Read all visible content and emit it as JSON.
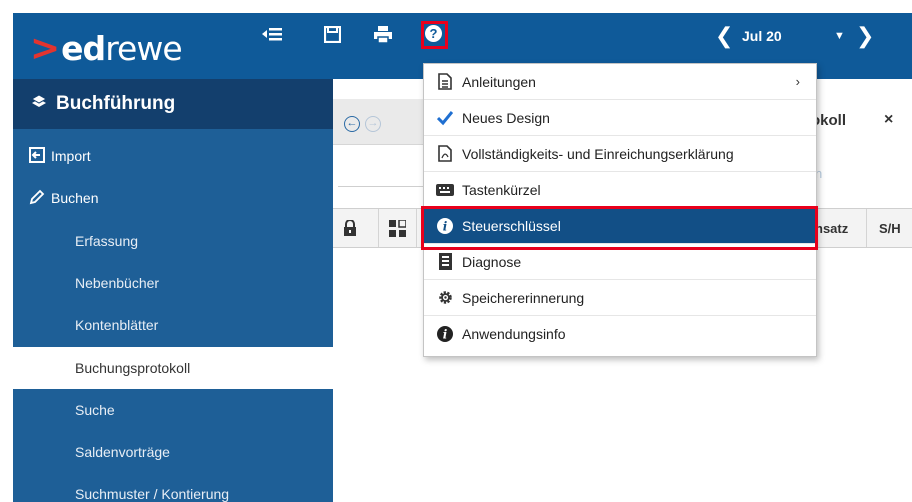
{
  "app": {
    "logo_prefix": "ed",
    "logo_suffix": "rewe"
  },
  "toolbar": {
    "period_label": "Jul 20",
    "icons": [
      "list-collapse-icon",
      "save-icon",
      "print-icon",
      "help-icon",
      "chevron-left-icon",
      "caret-down-icon",
      "chevron-right-icon"
    ]
  },
  "sidebar": {
    "header": "Buchführung",
    "items": [
      {
        "label": "Import",
        "icon": "import-icon",
        "level": "top"
      },
      {
        "label": "Buchen",
        "icon": "pencil-icon",
        "level": "top"
      },
      {
        "label": "Erfassung",
        "level": "sub"
      },
      {
        "label": "Nebenbücher",
        "level": "sub"
      },
      {
        "label": "Kontenblätter",
        "level": "sub"
      },
      {
        "label": "Buchungsprotokoll",
        "level": "sub",
        "active": true
      },
      {
        "label": "Suche",
        "level": "sub"
      },
      {
        "label": "Saldenvorträge",
        "level": "sub"
      },
      {
        "label": "Suchmuster / Kontierung",
        "level": "sub"
      }
    ]
  },
  "main": {
    "tab_label": "okoll",
    "tab_close": "×",
    "faded_text": "n",
    "columns": [
      "nsatz",
      "S/H"
    ]
  },
  "menu": {
    "items": [
      {
        "label": "Anleitungen",
        "icon": "document-icon",
        "has_submenu": true
      },
      {
        "label": "Neues Design",
        "icon": "checkbox-checked-icon"
      },
      {
        "label": "Vollständigkeits- und Einreichungserklärung",
        "icon": "pdf-icon"
      },
      {
        "label": "Tastenkürzel",
        "icon": "keyboard-icon"
      },
      {
        "label": "Steuerschlüssel",
        "icon": "info-bubble-icon",
        "selected": true
      },
      {
        "label": "Diagnose",
        "icon": "diagnose-icon"
      },
      {
        "label": "Speichererinnerung",
        "icon": "gear-icon"
      },
      {
        "label": "Anwendungsinfo",
        "icon": "info-bubble-icon"
      }
    ],
    "submenu_arrow": "›"
  },
  "colors": {
    "topbar": "#0f5a99",
    "sidebar": "#1e5f97",
    "sidebar_header": "#133f6d",
    "menu_selected": "#124f86",
    "highlight_border": "#e8001c",
    "logo_chevron": "#e3342f"
  }
}
